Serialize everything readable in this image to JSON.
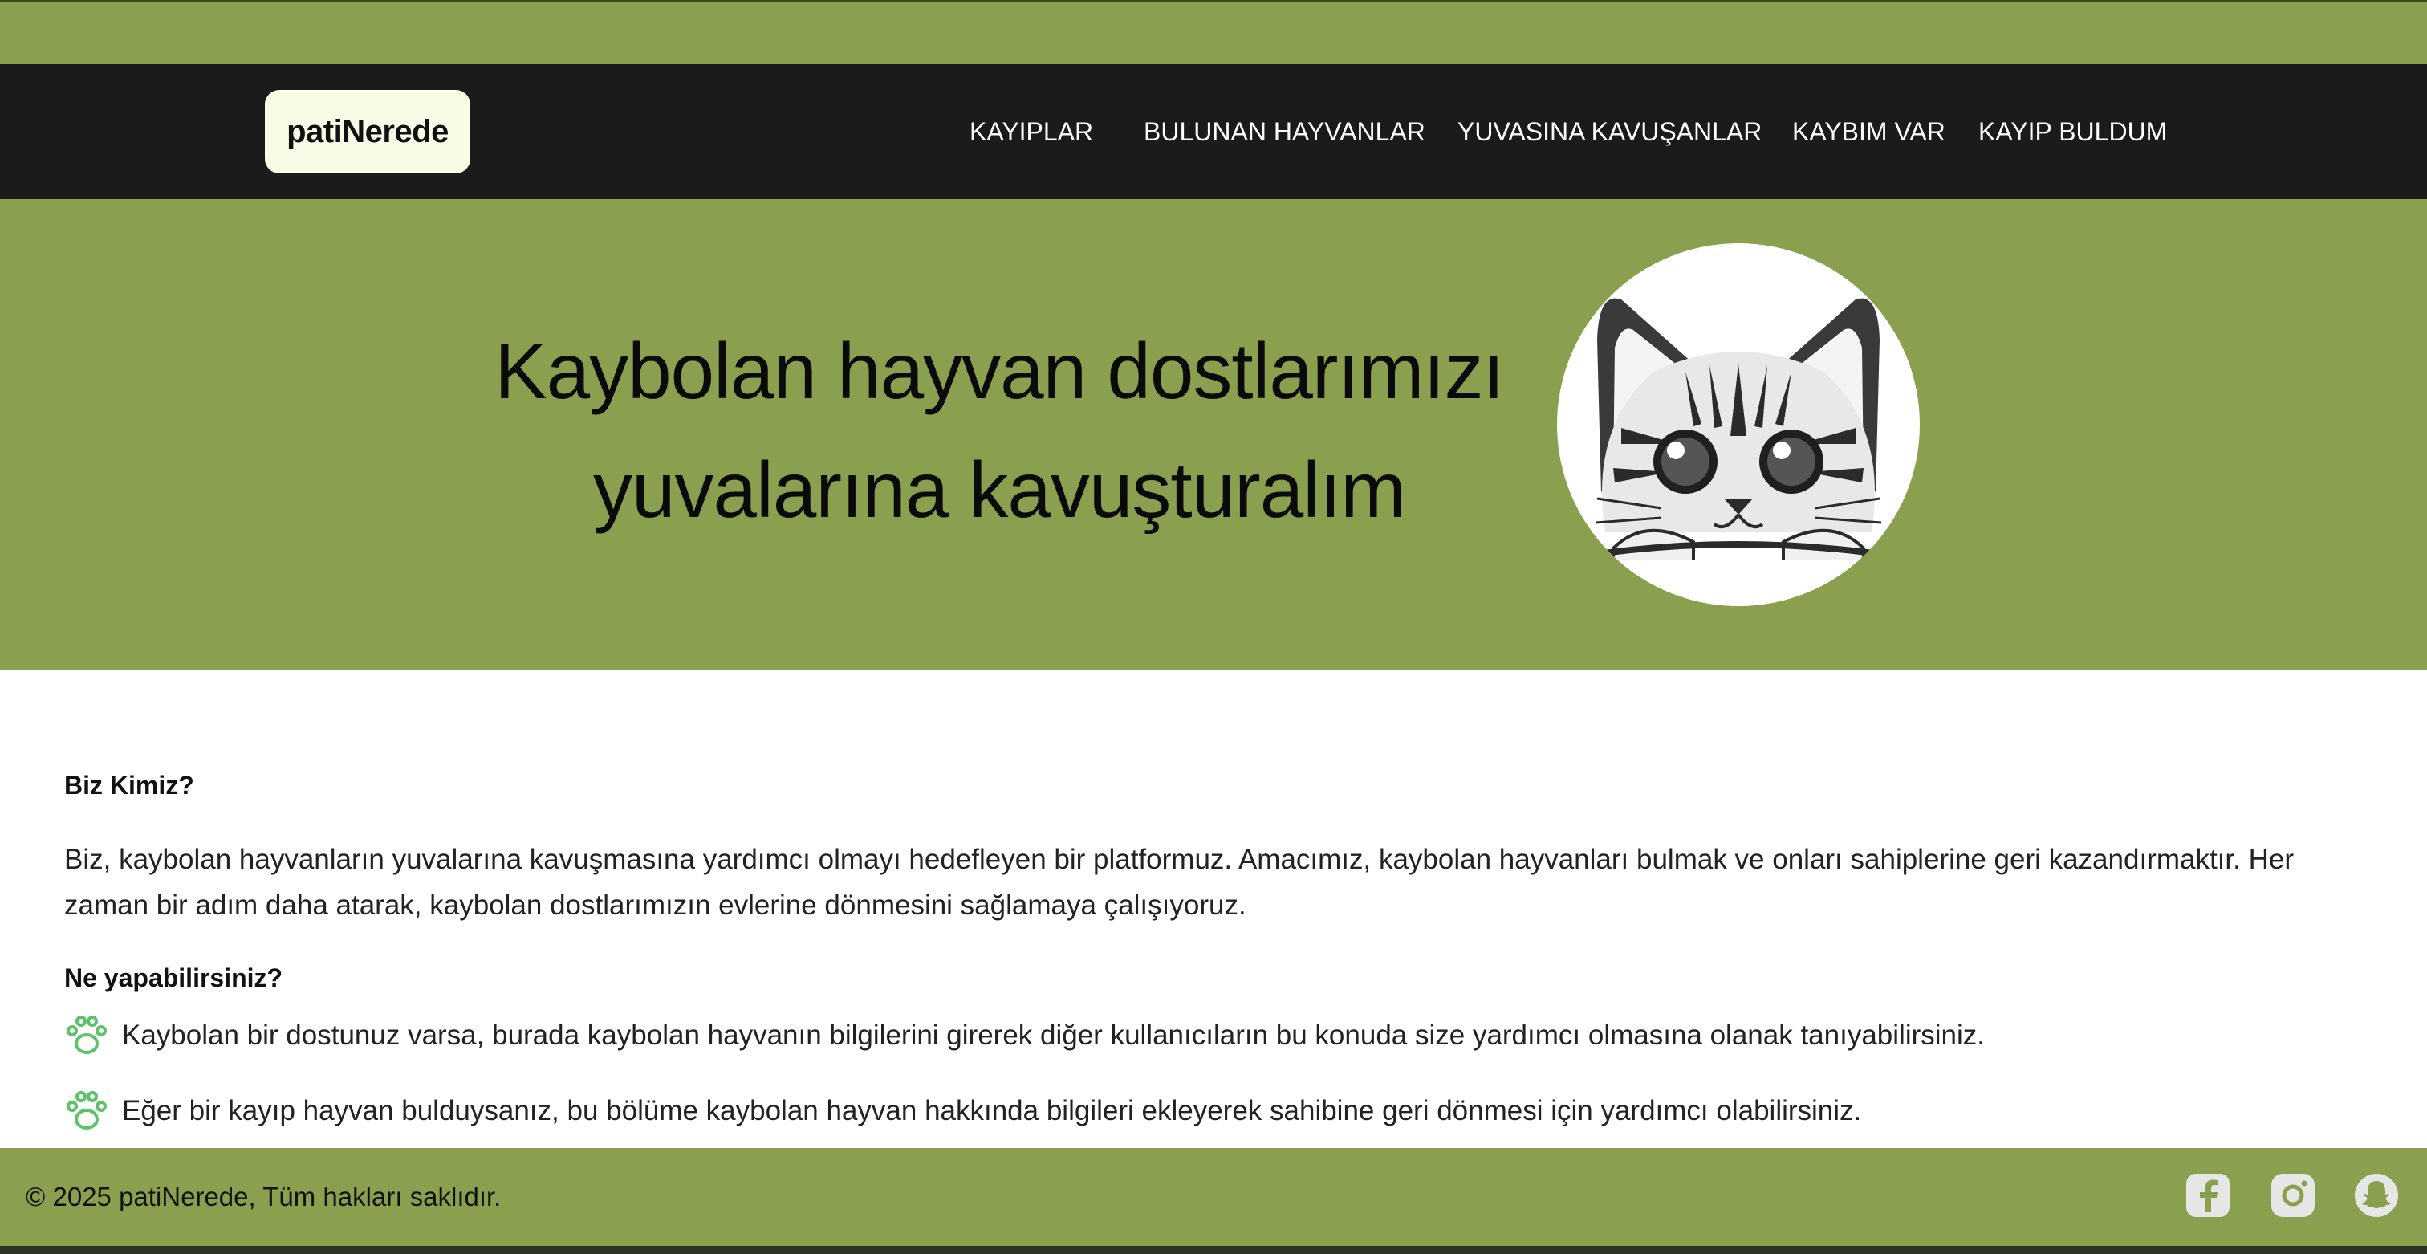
{
  "brand": {
    "logo_text": "patiNerede"
  },
  "nav": {
    "items": [
      {
        "label": "KAYIPLAR"
      },
      {
        "label": "BULUNAN HAYVANLAR"
      },
      {
        "label": "YUVASINA KAVUŞANLAR"
      },
      {
        "label": "KAYBIM VAR"
      },
      {
        "label": "KAYIP BULDUM"
      }
    ]
  },
  "hero": {
    "title_line1": "Kaybolan hayvan dostlarımızı",
    "title_line2": "yuvalarına kavuşturalım",
    "image_icon": "peeking-cat-illustration"
  },
  "about": {
    "heading": "Biz Kimiz?",
    "paragraph_line1": "Biz, kaybolan hayvanların yuvalarına kavuşmasına yardımcı olmayı hedefleyen bir platformuz. Amacımız, kaybolan hayvanları bulmak ve onları sahiplerine geri kazandırmaktır. Her",
    "paragraph_line2": "zaman bir adım daha atarak, kaybolan dostlarımızın evlerine dönmesini sağlamaya çalışıyoruz."
  },
  "actions": {
    "heading": "Ne yapabilirsiniz?",
    "items": [
      {
        "icon": "paw-icon",
        "text": "Kaybolan bir dostunuz varsa, burada kaybolan hayvanın bilgilerini girerek diğer kullanıcıların bu konuda size yardımcı olmasına olanak tanıyabilirsiniz."
      },
      {
        "icon": "paw-icon",
        "text": "Eğer bir kayıp hayvan bulduysanız, bu bölüme kaybolan hayvan hakkında bilgileri ekleyerek sahibine geri dönmesi için yardımcı olabilirsiniz."
      }
    ]
  },
  "footer": {
    "copyright": "© 2025 patiNerede, Tüm hakları saklıdır.",
    "social": [
      "facebook-icon",
      "instagram-icon",
      "snapchat-icon"
    ]
  },
  "colors": {
    "accent_green": "#8aa04e",
    "navbar": "#1b1b1b",
    "logo_bg": "#fafbe6",
    "paw_green": "#5cc36b"
  }
}
